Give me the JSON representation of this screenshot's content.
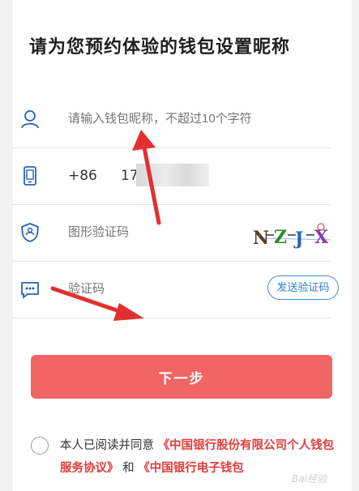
{
  "page": {
    "title": "请为您预约体验的钱包设置昵称"
  },
  "form": {
    "nickname": {
      "placeholder": "请输入钱包昵称，不超过10个字符"
    },
    "phone": {
      "country_code": "+86",
      "number_visible": "17"
    },
    "captcha": {
      "placeholder": "图形验证码",
      "image_text": "NZJX"
    },
    "sms": {
      "placeholder": "验证码",
      "send_button": "发送验证码"
    }
  },
  "actions": {
    "next_label": "下一步"
  },
  "agreement": {
    "prefix": "本人已阅读并同意",
    "link1": "《中国银行股份有限公司个人钱包服务协议》",
    "and": "和",
    "link2": "《中国银行电子钱包"
  },
  "watermark": "Bai经验",
  "colors": {
    "accent": "#f26565",
    "link": "#e23b3b",
    "icon": "#2a62b8",
    "sms_border": "#4a90e2"
  },
  "icons": [
    "user-icon",
    "phone-icon",
    "shield-icon",
    "message-icon"
  ]
}
